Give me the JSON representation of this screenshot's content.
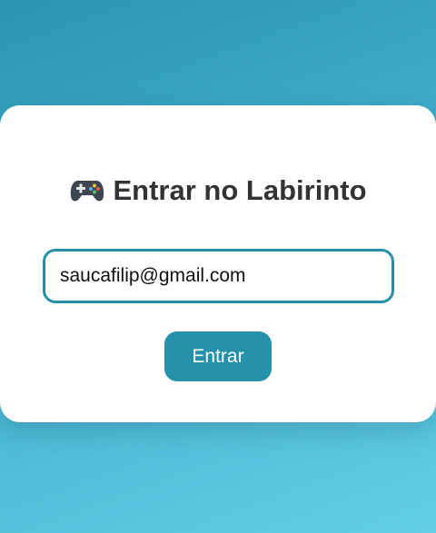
{
  "login": {
    "title": "Entrar no Labirinto",
    "title_icon": "gamepad-icon",
    "email_value": "saucafilip@gmail.com",
    "submit_label": "Entrar"
  },
  "colors": {
    "background_start": "#2a95b2",
    "background_end": "#62cfe7",
    "accent": "#2591ab",
    "title_text": "#333333"
  }
}
